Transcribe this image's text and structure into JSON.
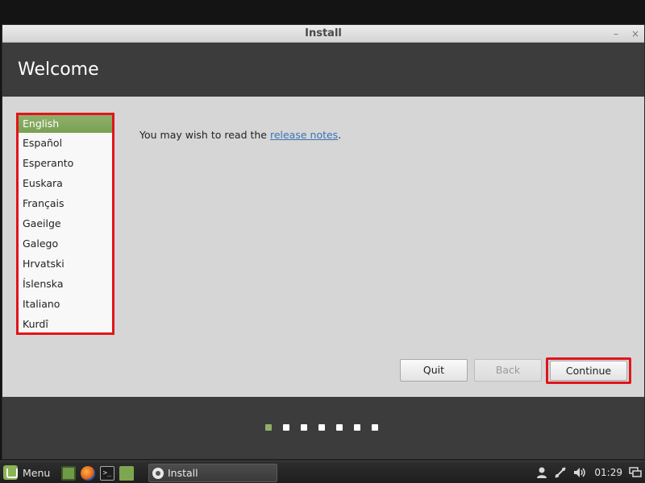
{
  "window": {
    "title": "Install",
    "minimize_glyph": "–",
    "close_glyph": "×"
  },
  "header": {
    "title": "Welcome"
  },
  "languages": {
    "selected": "English",
    "items": [
      "English",
      "Español",
      "Esperanto",
      "Euskara",
      "Français",
      "Gaeilge",
      "Galego",
      "Hrvatski",
      "Íslenska",
      "Italiano",
      "Kurdî"
    ]
  },
  "release": {
    "prefix": "You may wish to read the ",
    "link": "release notes",
    "suffix": "."
  },
  "buttons": {
    "quit": "Quit",
    "back": "Back",
    "continue": "Continue"
  },
  "progress": {
    "total_steps": 7,
    "current_step": 1
  },
  "taskbar": {
    "menu_label": "Menu",
    "window_label": "Install",
    "terminal_glyph": ">_",
    "clock": "01:29"
  },
  "colors": {
    "accent": "#8fb06a",
    "highlight_border": "#e0151b",
    "link": "#3b73b9",
    "header_bg": "#3c3c3c"
  }
}
